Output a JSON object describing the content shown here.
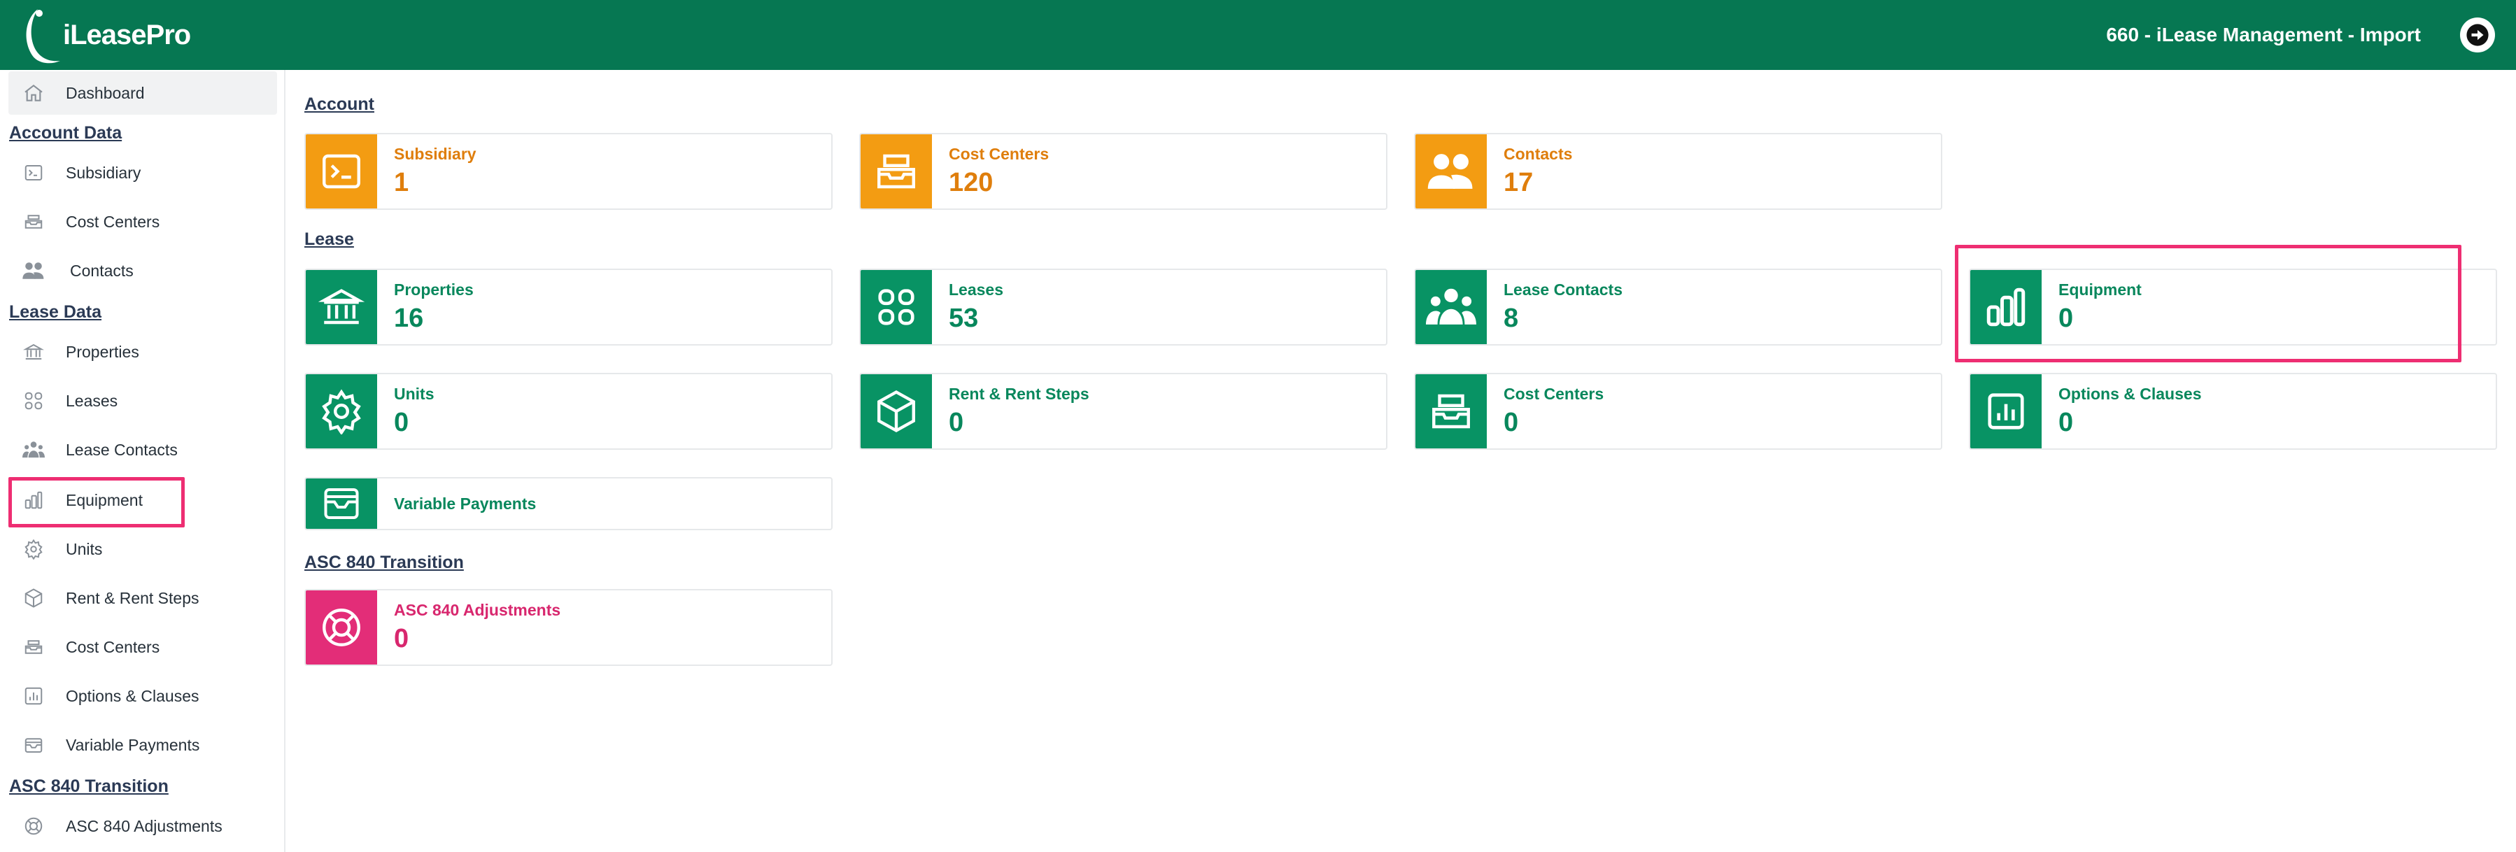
{
  "app": {
    "logo_text": "iLeasePro",
    "context_title": "660 - iLease Management - Import"
  },
  "colors": {
    "header": "#067752",
    "orange": "#f39c12",
    "green": "#089364",
    "pink": "#e32d78",
    "highlight": "#ee2e72"
  },
  "sidebar": {
    "dashboard": "Dashboard",
    "account_head": "Account Data",
    "account_items": [
      "Subsidiary",
      "Cost Centers",
      "Contacts"
    ],
    "lease_head": "Lease Data",
    "lease_items": [
      "Properties",
      "Leases",
      "Lease Contacts",
      "Equipment",
      "Units",
      "Rent & Rent Steps",
      "Cost Centers",
      "Options & Clauses",
      "Variable Payments"
    ],
    "asc_head": "ASC 840 Transition",
    "asc_items": [
      "ASC 840 Adjustments"
    ]
  },
  "main": {
    "account_title": "Account",
    "account_cards": [
      {
        "label": "Subsidiary",
        "value": "1",
        "icon": "terminal-icon"
      },
      {
        "label": "Cost Centers",
        "value": "120",
        "icon": "inbox-stack-icon"
      },
      {
        "label": "Contacts",
        "value": "17",
        "icon": "users-icon"
      }
    ],
    "lease_title": "Lease",
    "lease_cards": [
      {
        "label": "Properties",
        "value": "16",
        "icon": "bank-icon"
      },
      {
        "label": "Leases",
        "value": "53",
        "icon": "grid-icon"
      },
      {
        "label": "Lease Contacts",
        "value": "8",
        "icon": "group-icon"
      },
      {
        "label": "Equipment",
        "value": "0",
        "icon": "bar-chart-icon"
      },
      {
        "label": "Units",
        "value": "0",
        "icon": "gear-icon"
      },
      {
        "label": "Rent & Rent Steps",
        "value": "0",
        "icon": "cube-icon"
      },
      {
        "label": "Cost Centers",
        "value": "0",
        "icon": "inbox-stack-icon"
      },
      {
        "label": "Options & Clauses",
        "value": "0",
        "icon": "chart-square-icon"
      },
      {
        "label": "Variable Payments",
        "icon": "wallet-icon"
      }
    ],
    "asc_title": "ASC 840 Transition",
    "asc_cards": [
      {
        "label": "ASC 840 Adjustments",
        "value": "0",
        "icon": "lifebuoy-icon"
      }
    ]
  }
}
